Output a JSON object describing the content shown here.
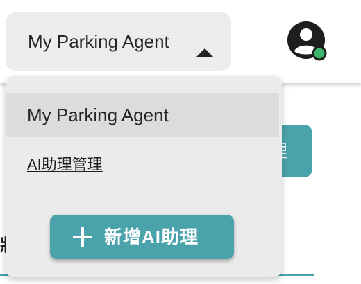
{
  "header": {
    "agent_selector": {
      "selected": "My Parking Agent",
      "caret_icon": "caret-up-icon"
    },
    "avatar": {
      "icon": "user-avatar-icon",
      "status_color": "#3bb46e"
    }
  },
  "dropdown": {
    "items": [
      {
        "label": "My Parking Agent",
        "selected": true
      }
    ],
    "manage_link": "AI助理管理",
    "add_button": {
      "label": "新增AI助理",
      "icon": "plus-icon"
    }
  },
  "background": {
    "button_text": "理",
    "label_text": "狀"
  },
  "colors": {
    "accent": "#4aa3ab",
    "selector_bg": "#ececec",
    "dropdown_bg": "#ebebeb",
    "selected_item_bg": "#dcdcdc"
  }
}
